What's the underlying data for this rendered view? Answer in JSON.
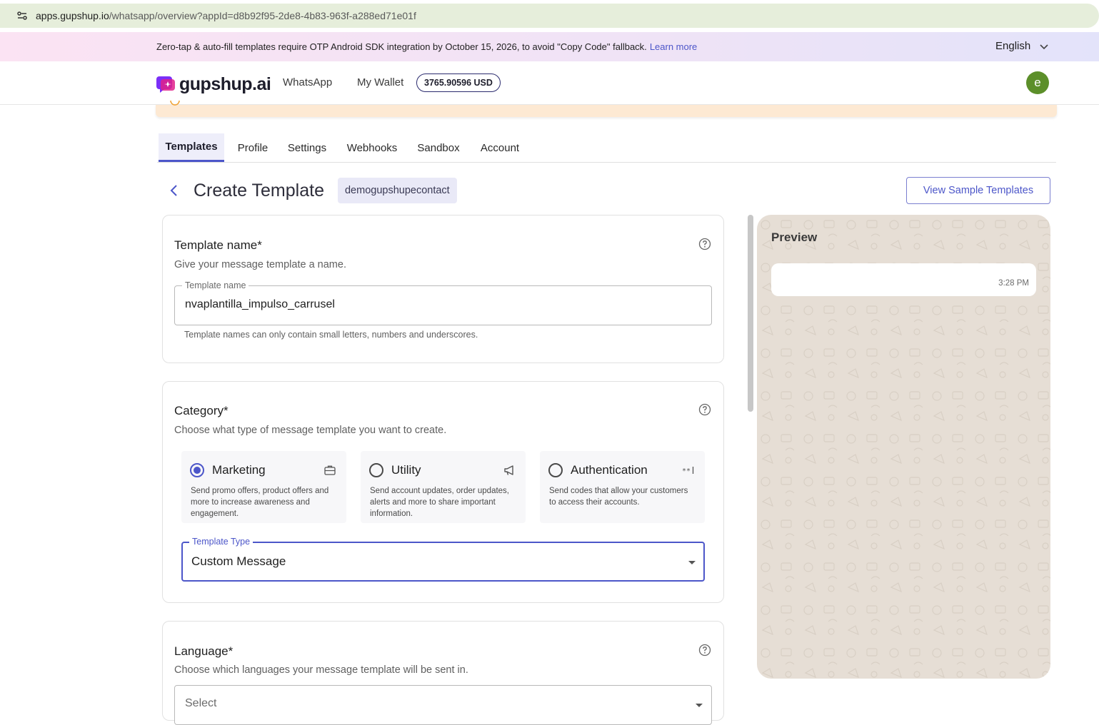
{
  "browser": {
    "url_host": "apps.gupshup.io",
    "url_path": "/whatsapp/overview?appId=d8b92f95-2de8-4b83-963f-a288ed71e01f"
  },
  "banner": {
    "text": "Zero-tap & auto-fill templates require OTP Android SDK integration by October 15, 2026, to avoid \"Copy Code\" fallback.",
    "link": "Learn more",
    "language": "English"
  },
  "nav": {
    "logo": "gupshup.ai",
    "links": [
      "WhatsApp",
      "My Wallet"
    ],
    "wallet_balance": "3765.90596 USD",
    "avatar_initial": "e"
  },
  "tabs": [
    "Templates",
    "Profile",
    "Settings",
    "Webhooks",
    "Sandbox",
    "Account"
  ],
  "header": {
    "title": "Create Template",
    "app_chip": "demogupshupecontact",
    "sample_button": "View Sample Templates"
  },
  "name_card": {
    "title": "Template name*",
    "subtitle": "Give your message template a name.",
    "field_label": "Template name",
    "field_value": "nvaplantilla_impulso_carrusel",
    "hint": "Template names can only contain small letters, numbers and underscores."
  },
  "category_card": {
    "title": "Category*",
    "subtitle": "Choose what type of message template you want to create.",
    "options": [
      {
        "label": "Marketing",
        "desc": "Send promo offers, product offers and more to increase awareness and engagement.",
        "selected": true,
        "icon": "briefcase-icon"
      },
      {
        "label": "Utility",
        "desc": "Send account updates, order updates, alerts and more to share important information.",
        "selected": false,
        "icon": "megaphone-icon"
      },
      {
        "label": "Authentication",
        "desc": "Send codes that allow your customers to access their accounts.",
        "selected": false,
        "icon": "password-icon"
      }
    ],
    "type_label": "Template Type",
    "type_value": "Custom Message"
  },
  "language_card": {
    "title": "Language*",
    "subtitle": "Choose which languages your message template will be sent in.",
    "select_placeholder": "Select"
  },
  "preview": {
    "title": "Preview",
    "time": "3:28 PM"
  },
  "colors": {
    "accent": "#4c56c9",
    "avatar": "#5c8f2a",
    "preview_bg": "#e6ded5"
  }
}
